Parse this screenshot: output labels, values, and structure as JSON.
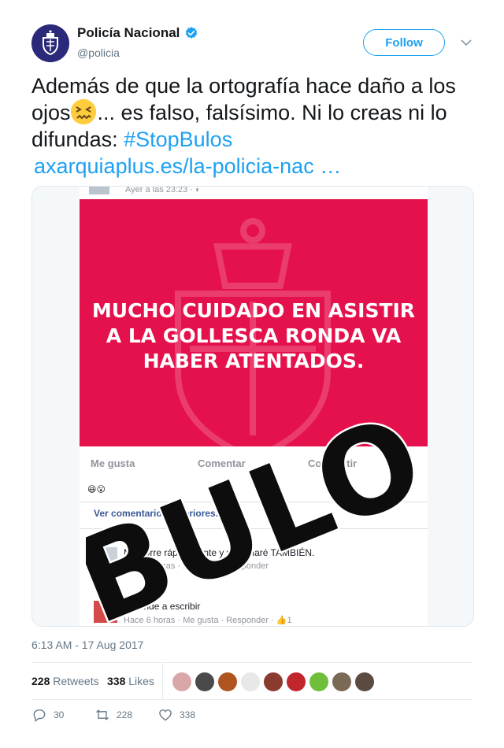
{
  "author": {
    "name": "Policía Nacional",
    "handle": "@policia",
    "verified": true
  },
  "follow_label": "Follow",
  "text": {
    "part1": "Además de que la ortografía hace daño a los ojos",
    "emoji": "confounded-face-emoji",
    "part2": "... es falso, falsísimo. Ni lo creas ni lo difundas: ",
    "hashtag": "#StopBulos",
    "link": "axarquiaplus.es/la-policia-nac   …"
  },
  "media": {
    "fb_time": "Ayer a las 23:23 · ◐",
    "hoax_message": [
      "MUCHO CUIDADO EN ASISTIR",
      "A LA GOLLESCA RONDA VA",
      "HABER ATENTADOS."
    ],
    "actions": [
      "Me gusta",
      "Comentar",
      "Compartir"
    ],
    "view_more": "Ver comentarios anteriores...",
    "comments": [
      {
        "text": "Me borre rápidamente y yo lo haré TAMBIÉN.",
        "meta": "Hace 6 horas · Me gusta · Responder"
      },
      {
        "text": "Aprende a escribir",
        "meta": "Hace 6 horas · Me gusta · Responder · 👍1"
      }
    ],
    "stamp": "BULO"
  },
  "timestamp": "6:13 AM - 17 Aug 2017",
  "stats": {
    "retweets_count": "228",
    "retweets_label": "Retweets",
    "likes_count": "338",
    "likes_label": "Likes"
  },
  "liker_colors": [
    "#d9a7a7",
    "#4a4a4a",
    "#b0541f",
    "#e8e8e8",
    "#8b3a2e",
    "#c0262c",
    "#6fbf3a",
    "#7a6a55",
    "#5a4a40"
  ],
  "actions": {
    "reply_count": "30",
    "retweet_count": "228",
    "like_count": "338"
  },
  "colors": {
    "accent": "#1da1f2",
    "hoax_red": "#e4114c",
    "police_blue": "#2b2a7a"
  }
}
